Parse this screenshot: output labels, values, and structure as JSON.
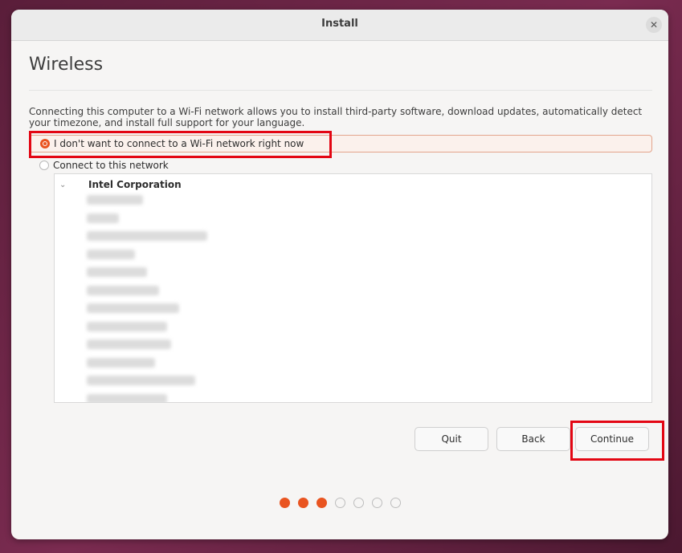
{
  "window": {
    "title": "Install"
  },
  "page": {
    "heading": "Wireless",
    "description": "Connecting this computer to a Wi-Fi network allows you to install third-party software, download updates, automatically detect your timezone, and install full support for your language."
  },
  "options": {
    "no_wifi": {
      "label": "I don't want to connect to a Wi-Fi network right now",
      "selected": true
    },
    "connect": {
      "label": "Connect to this network",
      "selected": false
    }
  },
  "network_list": {
    "group_label": "Intel Corporation",
    "expanded": true,
    "blurred_item_count": 12
  },
  "buttons": {
    "quit": "Quit",
    "back": "Back",
    "continue": "Continue"
  },
  "progress": {
    "total_steps": 7,
    "completed_steps": 3
  },
  "colors": {
    "accent": "#e95420",
    "highlight": "#e30613"
  }
}
